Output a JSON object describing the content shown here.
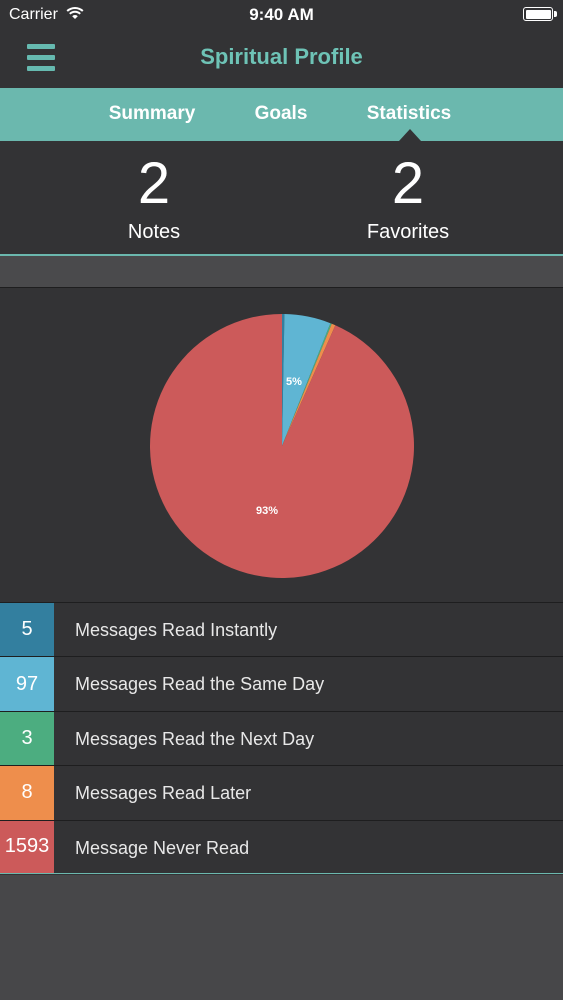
{
  "status_bar": {
    "carrier": "Carrier",
    "time": "9:40 AM",
    "wifi_icon": "wifi-icon",
    "battery_icon": "battery-full-icon"
  },
  "nav": {
    "title": "Spiritual Profile",
    "menu_icon": "hamburger-menu-icon"
  },
  "tabs": [
    {
      "label": "Summary",
      "active": false
    },
    {
      "label": "Goals",
      "active": false
    },
    {
      "label": "Statistics",
      "active": true
    }
  ],
  "counts": {
    "notes": {
      "value": "2",
      "label": "Notes"
    },
    "favorites": {
      "value": "2",
      "label": "Favorites"
    }
  },
  "pie": {
    "slice_labels": {
      "same_day": "5%",
      "never": "93%"
    }
  },
  "legend": [
    {
      "count": "5",
      "label": "Messages Read Instantly",
      "color": "#337f9f"
    },
    {
      "count": "97",
      "label": "Messages Read the Same Day",
      "color": "#5fb5d3"
    },
    {
      "count": "3",
      "label": "Messages Read the Next Day",
      "color": "#4cad80"
    },
    {
      "count": "8",
      "label": "Messages Read Later",
      "color": "#ee8e4c"
    },
    {
      "count": "1593",
      "label": "Message Never Read",
      "color": "#cc5a5a"
    }
  ],
  "colors": {
    "accent": "#6bb8ae",
    "background": "#333335",
    "instantly": "#337f9f",
    "same_day": "#5fb5d3",
    "next_day": "#4cad80",
    "later": "#ee8e4c",
    "never": "#cc5a5a"
  },
  "chart_data": {
    "type": "pie",
    "categories": [
      "Messages Read Instantly",
      "Messages Read the Same Day",
      "Messages Read the Next Day",
      "Messages Read Later",
      "Message Never Read"
    ],
    "values": [
      5,
      97,
      3,
      8,
      1593
    ],
    "title": ""
  }
}
